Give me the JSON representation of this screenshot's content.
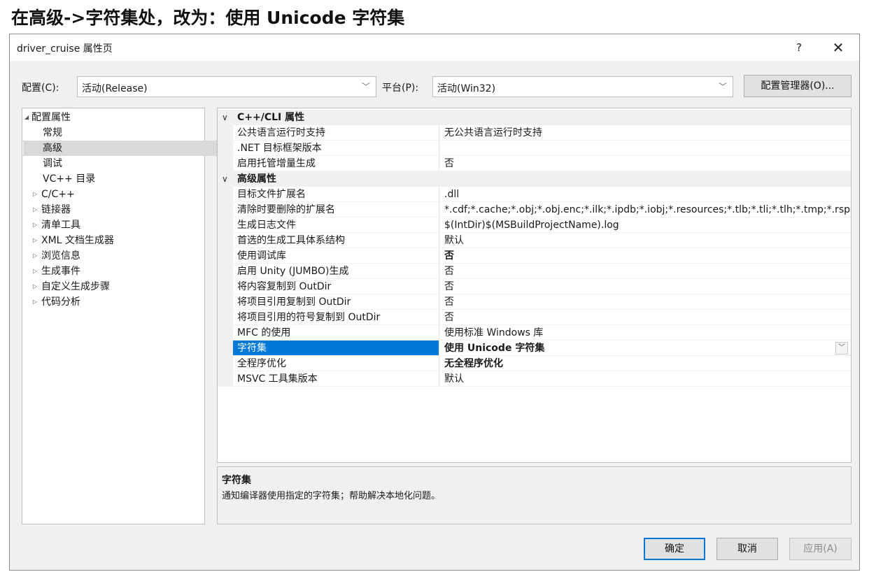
{
  "headline": "在高级->字符集处，改为：使用 Unicode 字符集",
  "window": {
    "title": "driver_cruise 属性页",
    "help_glyph": "?",
    "close_glyph": "✕"
  },
  "config": {
    "label": "配置(C):",
    "value": "活动(Release)",
    "platform_label": "平台(P):",
    "platform_value": "活动(Win32)",
    "manager_button": "配置管理器(O)..."
  },
  "tree": {
    "root": "配置属性",
    "items": [
      {
        "label": "常规"
      },
      {
        "label": "高级"
      },
      {
        "label": "调试"
      },
      {
        "label": "VC++ 目录"
      },
      {
        "label": "C/C++"
      },
      {
        "label": "链接器"
      },
      {
        "label": "清单工具"
      },
      {
        "label": "XML 文档生成器"
      },
      {
        "label": "浏览信息"
      },
      {
        "label": "生成事件"
      },
      {
        "label": "自定义生成步骤"
      },
      {
        "label": "代码分析"
      }
    ],
    "selected": "高级"
  },
  "grid": {
    "categories": [
      {
        "name": "C++/CLI 属性",
        "rows": [
          {
            "name": "公共语言运行时支持",
            "value": "无公共语言运行时支持"
          },
          {
            "name": ".NET 目标框架版本",
            "value": ""
          },
          {
            "name": "启用托管增量生成",
            "value": "否"
          }
        ]
      },
      {
        "name": "高级属性",
        "rows": [
          {
            "name": "目标文件扩展名",
            "value": ".dll"
          },
          {
            "name": "清除时要删除的扩展名",
            "value": "*.cdf;*.cache;*.obj;*.obj.enc;*.ilk;*.ipdb;*.iobj;*.resources;*.tlb;*.tli;*.tlh;*.tmp;*.rsp;*.pgc;*.pgd;*.meta;*.tlog;*.manifest;*.res;*.pch;*.exp;*.idb;*.rep;*.xdc;*.pdb;*_manifest.rc;*.bsc;*.sbr;*.xml;*.metagen;*.bi"
          },
          {
            "name": "生成日志文件",
            "value": "$(IntDir)$(MSBuildProjectName).log"
          },
          {
            "name": "首选的生成工具体系结构",
            "value": "默认"
          },
          {
            "name": "使用调试库",
            "value": "否",
            "bold": true
          },
          {
            "name": "启用 Unity (JUMBO)生成",
            "value": "否"
          },
          {
            "name": "将内容复制到 OutDir",
            "value": "否"
          },
          {
            "name": "将项目引用复制到 OutDir",
            "value": "否"
          },
          {
            "name": "将项目引用的符号复制到 OutDir",
            "value": "否"
          },
          {
            "name": "MFC 的使用",
            "value": "使用标准 Windows 库"
          },
          {
            "name": "字符集",
            "value": "使用 Unicode 字符集",
            "bold": true,
            "selected": true
          },
          {
            "name": "全程序优化",
            "value": "无全程序优化",
            "bold": true
          },
          {
            "name": "MSVC 工具集版本",
            "value": "默认"
          }
        ]
      }
    ]
  },
  "description": {
    "title": "字符集",
    "text": "通知编译器使用指定的字符集；帮助解决本地化问题。"
  },
  "buttons": {
    "ok": "确定",
    "cancel": "取消",
    "apply": "应用(A)"
  },
  "colors": {
    "selection": "#0078d7",
    "tree_selection": "#d9d9d9",
    "dialog_bg": "#f0f0f0"
  }
}
